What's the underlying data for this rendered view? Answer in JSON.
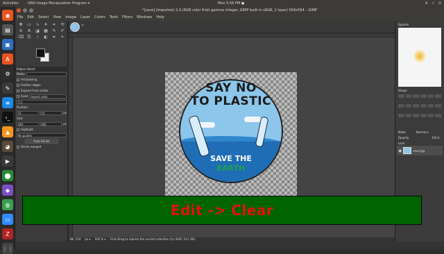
{
  "topbar": {
    "activities": "Activities",
    "app": "GNU Image Manipulation Program ▾",
    "clock": "Mon 5:56 PM ●"
  },
  "window": {
    "title": "*[save] (imported)-1.0 (RGB color 8-bit gamma integer, GIMP built-in sRGB, 1 layer) 564x564 – GIMP"
  },
  "menu": [
    "File",
    "Edit",
    "Select",
    "View",
    "Image",
    "Layer",
    "Colors",
    "Tools",
    "Filters",
    "Windows",
    "Help"
  ],
  "toolopts": {
    "title": "Ellipse Select",
    "mode": "Mode:",
    "antialias": "Antialiasing",
    "feather": "Feather edges",
    "expand": "Expand from center",
    "fixed": "Fixed",
    "aspect": "Aspect ratio",
    "ratio": "1:1",
    "position_label": "Position:",
    "pos_x": "51",
    "pos_y": "51",
    "size_label": "Size:",
    "size_w": "481",
    "size_h": "481",
    "unit": "px",
    "highlight": "Highlight",
    "guides": "No guides",
    "autoshrink": "Auto Shrink",
    "shrink_merged": "Shrink merged"
  },
  "image": {
    "line1": "SAY NO",
    "line2": "TO PLASTIC",
    "save": "SAVE THE",
    "earth": "EARTH"
  },
  "status": {
    "coords": "86, 134",
    "unit": "px ▾",
    "zoom": "100 % ▾",
    "message": "Click-Drag to replace the current selection (try Shift, Ctrl, Alt)"
  },
  "dock": {
    "brushes_title": "Sparkle",
    "shape": "Shape",
    "mode_label": "Mode",
    "mode_value": "Normal ▾",
    "opacity_label": "Opacity",
    "opacity_value": "100.0",
    "lock_label": "Lock:",
    "layer_name": "save.jpg"
  },
  "overlay": {
    "text": "Edit -> Clear"
  },
  "colors": {
    "overlay_bg": "#006400",
    "overlay_text": "#e31010",
    "accent": "#e05a2b"
  }
}
